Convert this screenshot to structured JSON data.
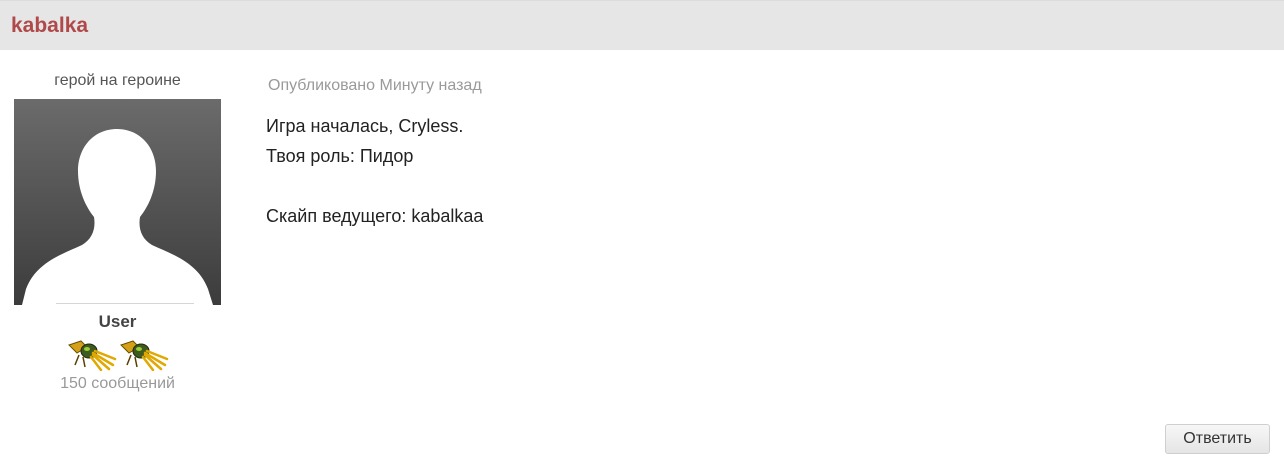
{
  "post": {
    "author": "kabalka",
    "timestamp": "Опубликовано Минуту назад",
    "lines": [
      "Игра началась, Cryless.",
      "Твоя роль: Пидор",
      "",
      "Скайп ведущего: kabalkaa"
    ]
  },
  "profile": {
    "title": "герой на героине",
    "avatar_icon": "default-user-silhouette-icon",
    "group": "User",
    "rank_icons": [
      "rank-pip-icon",
      "rank-pip-icon"
    ],
    "post_count": "150 сообщений"
  },
  "actions": {
    "reply_label": "Ответить"
  },
  "colors": {
    "author": "#b04a4a",
    "header_bg": "#e6e6e6",
    "muted_text": "#9a9a9a"
  }
}
